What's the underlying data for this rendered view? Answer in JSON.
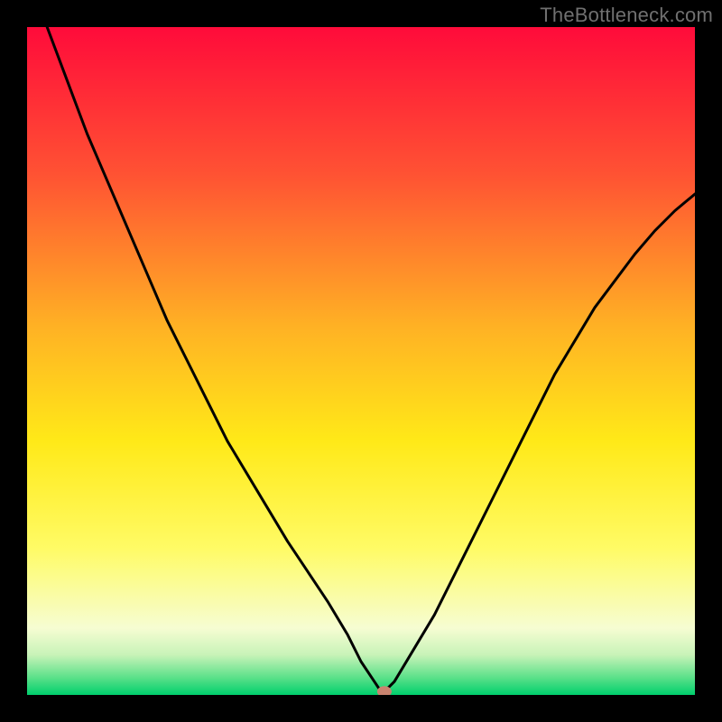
{
  "watermark": "TheBottleneck.com",
  "chart_data": {
    "type": "line",
    "title": "",
    "xlabel": "",
    "ylabel": "",
    "xlim": [
      0,
      100
    ],
    "ylim": [
      0,
      100
    ],
    "grid": false,
    "series": [
      {
        "name": "curve",
        "x": [
          0,
          3,
          6,
          9,
          12,
          15,
          18,
          21,
          24,
          27,
          30,
          33,
          36,
          39,
          42,
          45,
          48,
          50,
          52,
          53,
          53.5,
          55,
          58,
          61,
          64,
          67,
          70,
          73,
          76,
          79,
          82,
          85,
          88,
          91,
          94,
          97,
          100
        ],
        "y": [
          110,
          100,
          92,
          84,
          77,
          70,
          63,
          56,
          50,
          44,
          38,
          33,
          28,
          23,
          18.5,
          14,
          9,
          5,
          2,
          0.5,
          0.5,
          2,
          7,
          12,
          18,
          24,
          30,
          36,
          42,
          48,
          53,
          58,
          62,
          66,
          69.5,
          72.5,
          75
        ]
      }
    ],
    "marker": {
      "x": 53.5,
      "y": 0.5,
      "color": "#c9836f"
    },
    "background": {
      "type": "vertical-gradient",
      "stops": [
        {
          "pct": 0,
          "color": "#ff0b3a"
        },
        {
          "pct": 22,
          "color": "#ff5233"
        },
        {
          "pct": 45,
          "color": "#ffb224"
        },
        {
          "pct": 62,
          "color": "#ffe918"
        },
        {
          "pct": 78,
          "color": "#fffb65"
        },
        {
          "pct": 90,
          "color": "#f6fdd2"
        },
        {
          "pct": 94,
          "color": "#c8f3b8"
        },
        {
          "pct": 97.5,
          "color": "#58e088"
        },
        {
          "pct": 100,
          "color": "#00cf6d"
        }
      ]
    }
  }
}
